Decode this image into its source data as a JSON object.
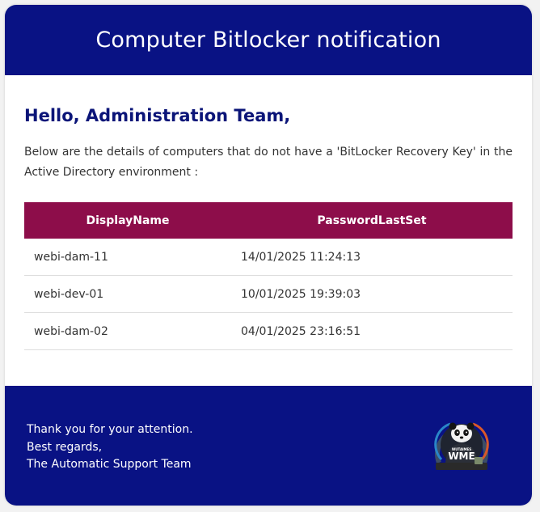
{
  "header": {
    "title": "Computer Bitlocker notification"
  },
  "content": {
    "greeting": "Hello, Administration Team,",
    "intro": "Below are the details of computers that do not have a 'BitLocker Recovery Key' in the Active Directory environment :"
  },
  "table": {
    "columns": [
      "DisplayName",
      "PasswordLastSet"
    ],
    "rows": [
      [
        "webi-dam-11",
        "14/01/2025 11:24:13"
      ],
      [
        "webi-dev-01",
        "10/01/2025 19:39:03"
      ],
      [
        "webi-dam-02",
        "04/01/2025 23:16:51"
      ]
    ]
  },
  "footer": {
    "lines": [
      "Thank you for your attention.",
      "Best regards,",
      "The Automatic Support Team"
    ],
    "logo_text": "WME",
    "logo_small_text": "WUTAIMES"
  },
  "colors": {
    "header_bg": "#091284",
    "table_header_bg": "#8d0d4a",
    "greeting_text": "#0b1578"
  }
}
